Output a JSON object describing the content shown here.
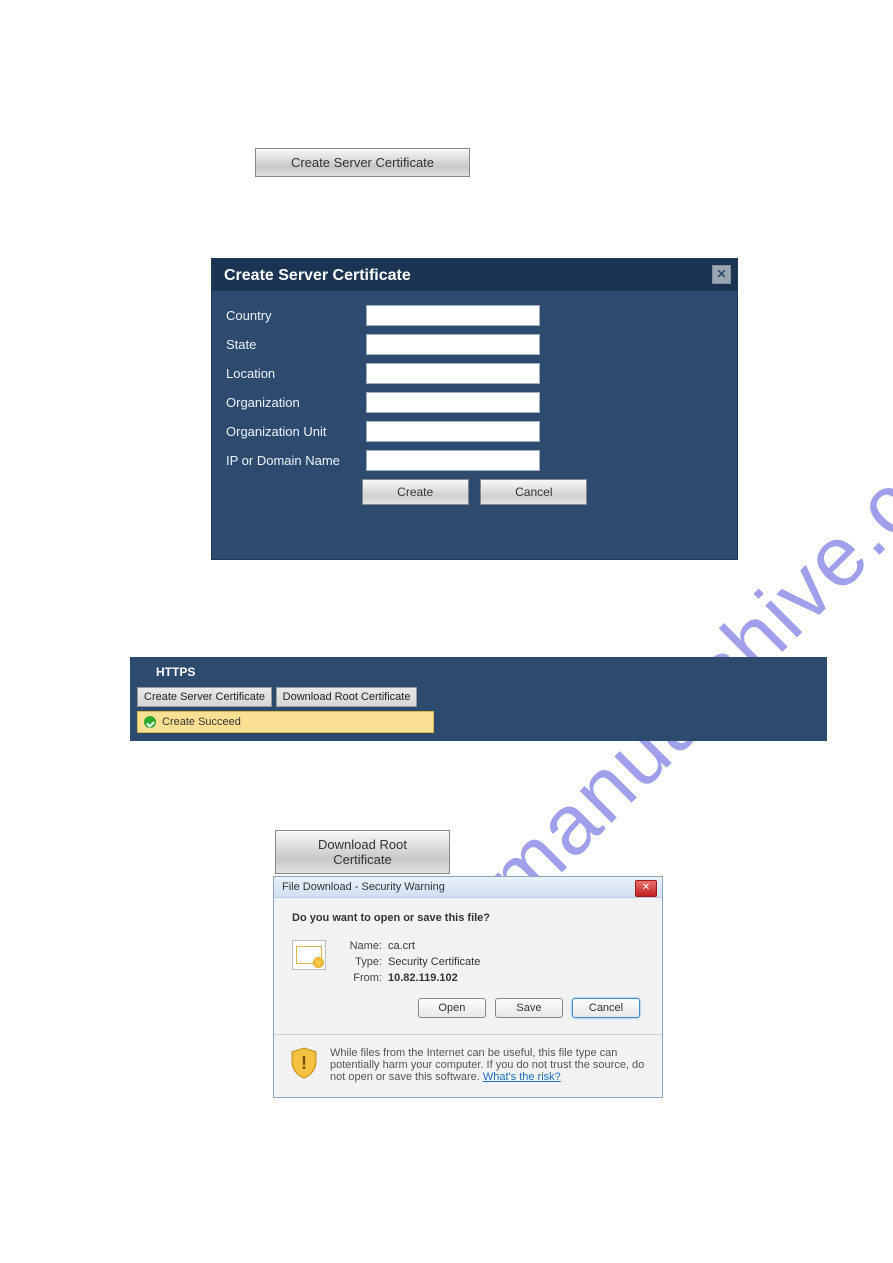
{
  "watermark": "manualshive.com",
  "top_button_label": "Create Server Certificate",
  "cert_modal": {
    "title": "Create Server Certificate",
    "fields": {
      "country": "Country",
      "state": "State",
      "location": "Location",
      "organization": "Organization",
      "org_unit": "Organization Unit",
      "ip_or_domain": "IP or Domain Name"
    },
    "create_label": "Create",
    "cancel_label": "Cancel"
  },
  "https_panel": {
    "title": "HTTPS",
    "btn_create": "Create Server Certificate",
    "btn_download": "Download Root Certificate",
    "success_msg": "Create Succeed"
  },
  "download_root_btn": "Download Root Certificate",
  "win_dialog": {
    "title": "File Download - Security Warning",
    "question": "Do you want to open or save this file?",
    "name_label": "Name:",
    "name_value": "ca.crt",
    "type_label": "Type:",
    "type_value": "Security Certificate",
    "from_label": "From:",
    "from_value": "10.82.119.102",
    "open_label": "Open",
    "save_label": "Save",
    "cancel_label": "Cancel",
    "warning_text": "While files from the Internet can be useful, this file type can potentially harm your computer. If you do not trust the source, do not open or save this software. ",
    "risk_link": "What's the risk?"
  }
}
